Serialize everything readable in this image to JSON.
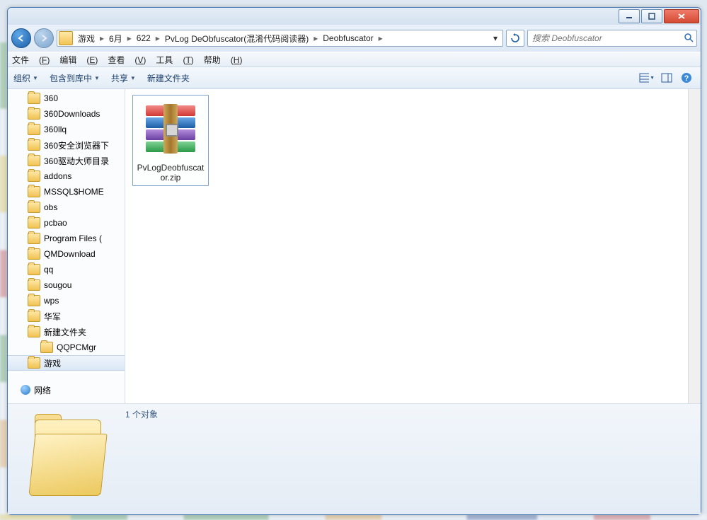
{
  "breadcrumb": {
    "items": [
      "游戏",
      "6月",
      "622",
      "PvLog DeObfuscator(混淆代码阅读器)",
      "Deobfuscator"
    ]
  },
  "search": {
    "placeholder": "搜索 Deobfuscator"
  },
  "menubar": {
    "file": {
      "label": "文件",
      "key": "F"
    },
    "edit": {
      "label": "编辑",
      "key": "E"
    },
    "view": {
      "label": "查看",
      "key": "V"
    },
    "tools": {
      "label": "工具",
      "key": "T"
    },
    "help": {
      "label": "帮助",
      "key": "H"
    }
  },
  "toolbar": {
    "organize": "组织",
    "include": "包含到库中",
    "share": "共享",
    "newfolder": "新建文件夹"
  },
  "sidebar": {
    "items": [
      {
        "label": "360"
      },
      {
        "label": "360Downloads"
      },
      {
        "label": "360llq"
      },
      {
        "label": "360安全浏览器下"
      },
      {
        "label": "360驱动大师目录"
      },
      {
        "label": "addons"
      },
      {
        "label": "MSSQL$HOME"
      },
      {
        "label": "obs"
      },
      {
        "label": "pcbao"
      },
      {
        "label": "Program Files ("
      },
      {
        "label": "QMDownload"
      },
      {
        "label": "qq"
      },
      {
        "label": "sougou"
      },
      {
        "label": "wps"
      },
      {
        "label": "华军"
      },
      {
        "label": "新建文件夹"
      },
      {
        "label": "QQPCMgr",
        "indent": true
      },
      {
        "label": "游戏",
        "selected": true
      }
    ],
    "network": "网络"
  },
  "files": [
    {
      "name": "PvLogDeobfuscator.zip",
      "type": "archive"
    }
  ],
  "status": {
    "text": "1 个对象"
  }
}
